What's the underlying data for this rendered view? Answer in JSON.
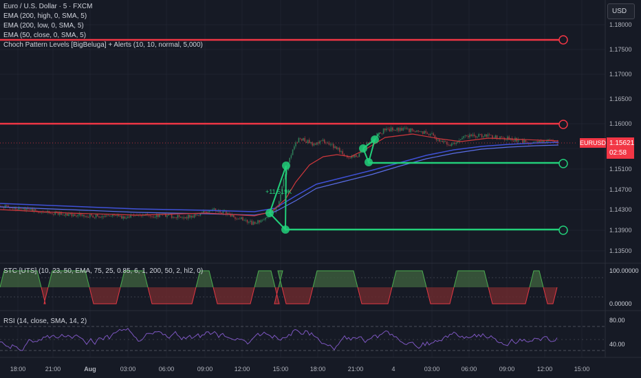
{
  "legend": {
    "symbol": "Euro / U.S. Dollar · 5 · FXCM",
    "lines": [
      "EMA (200, high, 0, SMA, 5)",
      "EMA (200, low, 0, SMA, 5)",
      "EMA (50, close, 0, SMA, 5)",
      "Choch Pattern Levels [BigBeluga] + Alerts (10, 10, normal, 5,000)"
    ]
  },
  "currency_button": "USD",
  "price_scale": {
    "labels": [
      "1.18000",
      "1.17500",
      "1.17000",
      "1.16500",
      "1.16000",
      "1.15500",
      "1.15100",
      "1.14700",
      "1.14300",
      "1.13900",
      "1.13500"
    ]
  },
  "last_price": {
    "symbol_tag": "EURUSD",
    "price": "1.15621",
    "countdown": "02:58"
  },
  "annotations": {
    "move_label": "+11,519K",
    "small_label": "K"
  },
  "stc": {
    "title": "STC [UTS] (10, 23, 50, EMA, 75, 25, 0.85, 6, 1, 200, 50, 2, hl2, 0)",
    "scale_labels": [
      "100.00000",
      "0.00000"
    ]
  },
  "rsi": {
    "title": "RSI (14, close, SMA, 14, 2)",
    "scale_labels": [
      "80.00",
      "40.00"
    ]
  },
  "time_axis": {
    "labels": [
      "18:00",
      "21:00",
      "Aug",
      "03:00",
      "06:00",
      "09:00",
      "12:00",
      "15:00",
      "18:00",
      "21:00",
      "4",
      "03:00",
      "06:00",
      "09:00",
      "12:00",
      "15:00"
    ]
  },
  "colors": {
    "background": "#161a25",
    "resistance": "#f23645",
    "support": "#22d07a",
    "ema_blue": "#3f51d8",
    "ema_red": "#d0383c",
    "candle_up": "#2e7d58",
    "candle_down": "#9c3a3f",
    "stc_up": "#3b5c3c",
    "stc_down": "#6a2a2e",
    "rsi_line": "#7e57c2"
  }
}
